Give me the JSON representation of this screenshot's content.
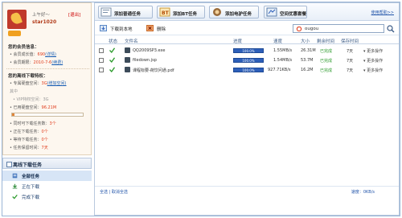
{
  "profile": {
    "greeting": "上午好～",
    "logout": "[退出]",
    "username": "star1020",
    "member_title": "您的会员信息：",
    "growth_label": "• 会员成长值：",
    "growth_value": "690",
    "growth_link": "(详情)",
    "expiry_label": "• 会员期限：",
    "expiry_value": "2010-7-6",
    "expiry_link": "(续费)",
    "offline_title": "您的离线下载特权：",
    "space_label": "• 专属硬盘空间：",
    "space_value": "3G",
    "space_link": "(增加空间)",
    "including": "其中",
    "vip_label": "• VIP特权空间：3G",
    "used_label": "• 已用硬盘空间：",
    "used_value": "96.21M",
    "concurrent_label": "• 同时可下载任务数：",
    "concurrent_value": "3个",
    "downloading_label": "• 正在下载任务：",
    "downloading_value": "0个",
    "waiting_label": "• 等待下载任务：",
    "waiting_value": "0个",
    "retention_label": "• 任务保留时间：",
    "retention_value": "7天"
  },
  "nav": {
    "header": "离线下载任务",
    "items": [
      "全部任务",
      "正在下载",
      "完成下载"
    ]
  },
  "toolbar": {
    "add_normal": "添加普通任务",
    "add_bt": "添加BT任务",
    "add_emule": "添加电驴任务",
    "space_offer": "空间优惠套餐",
    "help": "使用帮助>>"
  },
  "actions": {
    "download_local": "下载到本地",
    "delete": "删除",
    "search_value": "ougou"
  },
  "table": {
    "headers": [
      "状态",
      "文件名",
      "进度",
      "速度",
      "大小",
      "剩余时间",
      "保存时间"
    ],
    "rows": [
      {
        "name": "QQ2009SP3.exe",
        "progress": "100.0%",
        "speed": "1.55MB/s",
        "size": "26.31M",
        "remain": "已完成",
        "keep": "7天",
        "more": "更多操作"
      },
      {
        "name": "filedown.jsp",
        "progress": "100.0%",
        "speed": "1.54MB/s",
        "size": "53.7M",
        "remain": "已完成",
        "keep": "7天",
        "more": "更多操作"
      },
      {
        "name": "课程标要-荷饮问通.pdf",
        "progress": "100.0%",
        "speed": "927.71KB/s",
        "size": "16.2M",
        "remain": "已完成",
        "keep": "7天",
        "more": "更多操作"
      }
    ]
  },
  "footer": {
    "select": "全选 | 取消全选",
    "speed": "速度：0KB/s"
  },
  "colors": {
    "accent": "#2d5fb9",
    "done": "#2a9a2a",
    "link_red": "#e03c1c"
  }
}
